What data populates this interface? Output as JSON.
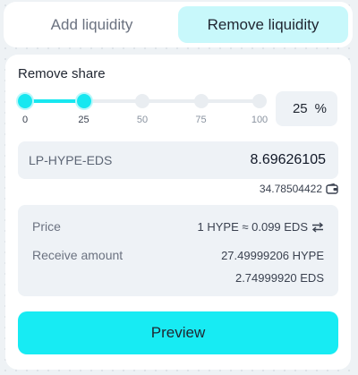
{
  "tabs": {
    "add_label": "Add liquidity",
    "remove_label": "Remove liquidity",
    "active": "remove"
  },
  "remove_share": {
    "label": "Remove share",
    "value_percent": 25,
    "ticks": [
      "0",
      "25",
      "50",
      "75",
      "100"
    ],
    "input_value": "25",
    "unit": "%"
  },
  "lp_token": {
    "name": "LP-HYPE-EDS",
    "amount": "8.69626105",
    "balance": "34.78504422",
    "balance_icon": "wallet-icon"
  },
  "info": {
    "price_label": "Price",
    "price_value": "1 HYPE ≈ 0.099 EDS",
    "price_icon": "swap-icon",
    "receive_label": "Receive amount",
    "receive_values": [
      "27.49999206 HYPE",
      "2.74999920 EDS"
    ]
  },
  "preview_button": {
    "label": "Preview"
  },
  "colors": {
    "accent": "#17ebf3",
    "active_tab": "#c8f8fb",
    "field_bg": "#eef2f6"
  }
}
